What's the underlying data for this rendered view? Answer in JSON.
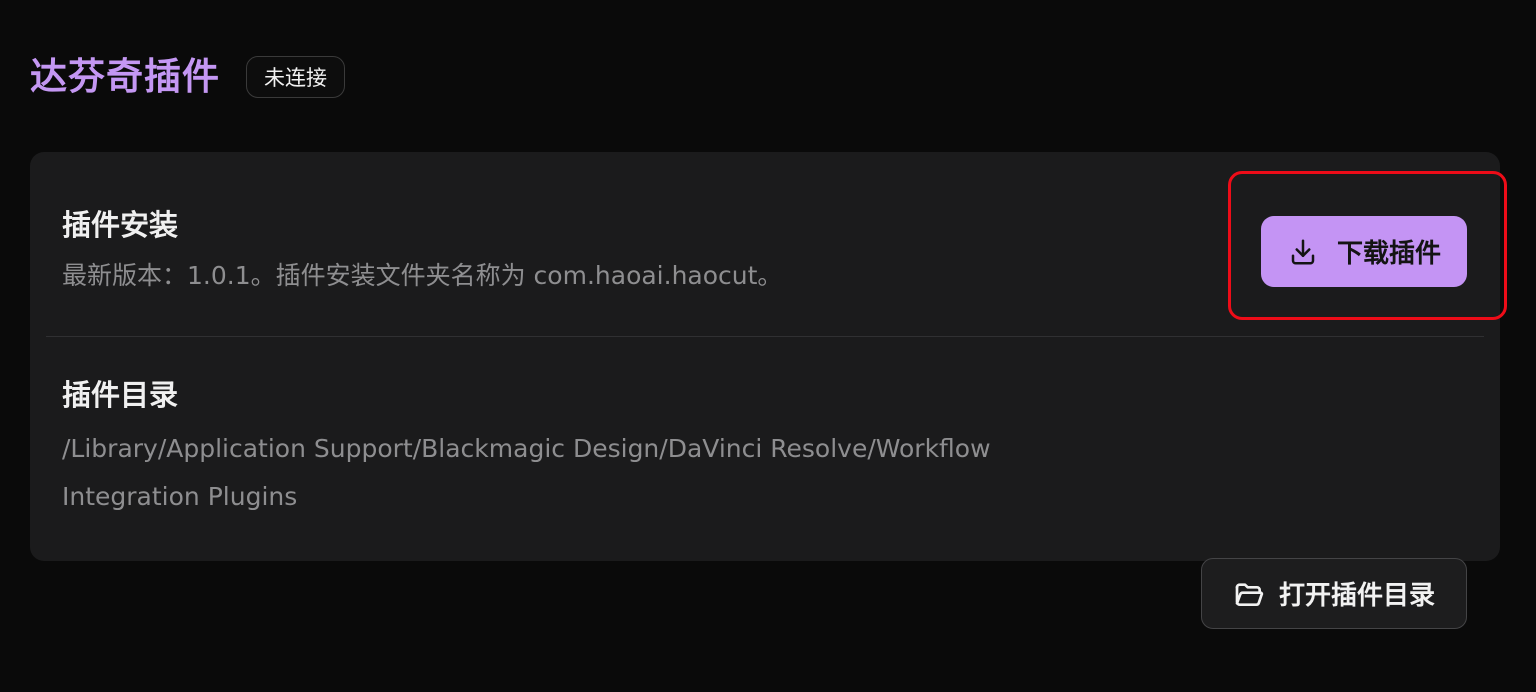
{
  "header": {
    "title": "达芬奇插件",
    "status_badge": "未连接"
  },
  "install": {
    "title": "插件安装",
    "description": "最新版本：1.0.1。插件安装文件夹名称为 com.haoai.haocut。",
    "button_label": "下载插件",
    "button_icon": "download-icon"
  },
  "directory": {
    "title": "插件目录",
    "path": "/Library/Application Support/Blackmagic Design/DaVinci Resolve/Workflow Integration Plugins",
    "button_label": "打开插件目录",
    "button_icon": "folder-open-icon"
  },
  "colors": {
    "accent": "#c494f4",
    "highlight": "#ee0c18",
    "background": "#0a0a0a",
    "card": "#1b1b1c"
  }
}
